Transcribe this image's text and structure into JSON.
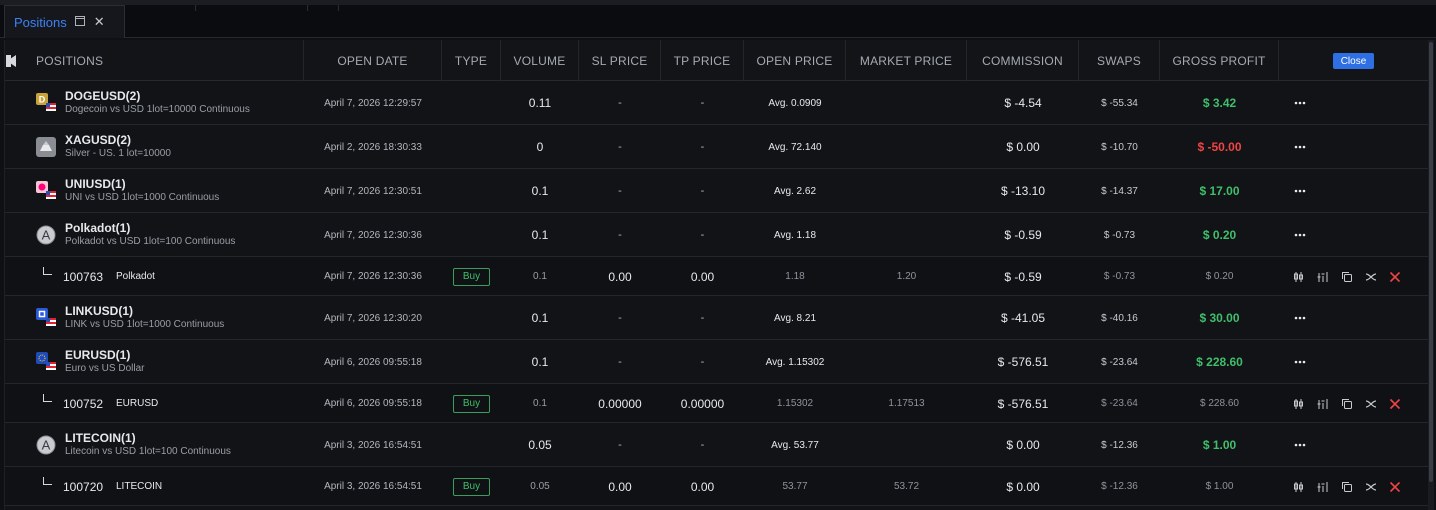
{
  "tab": {
    "label": "Positions"
  },
  "headers": {
    "positions": "POSITIONS",
    "open_date": "OPEN DATE",
    "type": "TYPE",
    "volume": "VOLUME",
    "sl_price": "SL PRICE",
    "tp_price": "TP PRICE",
    "open_price": "OPEN PRICE",
    "market_price": "MARKET PRICE",
    "commission": "COMMISSION",
    "swaps": "SWAPS",
    "gross_profit": "GROSS PROFIT",
    "close_button": "Close"
  },
  "rows": [
    {
      "kind": "group",
      "icon": "doge",
      "symbol": "DOGEUSD(2)",
      "desc": "Dogecoin vs USD 1lot=10000 Continuous",
      "date": "April 7, 2026 12:29:57",
      "volume": "0.11",
      "sl": "-",
      "tp": "-",
      "open": "Avg. 0.0909",
      "commission": "$ -4.54",
      "swaps": "$ -55.34",
      "profit": "$ 3.42",
      "sign": "pos"
    },
    {
      "kind": "group",
      "icon": "silver",
      "symbol": "XAGUSD(2)",
      "desc": "Silver - US. 1 lot=10000",
      "date": "April 2, 2026 18:30:33",
      "volume": "0",
      "sl": "-",
      "tp": "-",
      "open": "Avg. 72.140",
      "commission": "$ 0.00",
      "swaps": "$ -10.70",
      "profit": "$ -50.00",
      "sign": "neg"
    },
    {
      "kind": "group",
      "icon": "uni",
      "symbol": "UNIUSD(1)",
      "desc": "UNI vs USD 1lot=1000 Continuous",
      "date": "April 7, 2026 12:30:51",
      "volume": "0.1",
      "sl": "-",
      "tp": "-",
      "open": "Avg. 2.62",
      "commission": "$ -13.10",
      "swaps": "$ -14.37",
      "profit": "$ 17.00",
      "sign": "pos"
    },
    {
      "kind": "group",
      "icon": "letter",
      "symbol": "Polkadot(1)",
      "desc": "Polkadot vs USD 1lot=100 Continuous",
      "date": "April 7, 2026 12:30:36",
      "volume": "0.1",
      "sl": "-",
      "tp": "-",
      "open": "Avg. 1.18",
      "commission": "$ -0.59",
      "swaps": "$ -0.73",
      "profit": "$ 0.20",
      "sign": "pos"
    },
    {
      "kind": "sub",
      "ticket": "100763",
      "symbol": "Polkadot",
      "date": "April 7, 2026 12:30:36",
      "type": "Buy",
      "volume": "0.1",
      "sl": "0.00",
      "tp": "0.00",
      "open": "1.18",
      "market": "1.20",
      "commission": "$ -0.59",
      "swaps": "$ -0.73",
      "profit": "$ 0.20",
      "sign": "pos"
    },
    {
      "kind": "group",
      "icon": "link",
      "symbol": "LINKUSD(1)",
      "desc": "LINK vs USD 1lot=1000 Continuous",
      "date": "April 7, 2026 12:30:20",
      "volume": "0.1",
      "sl": "-",
      "tp": "-",
      "open": "Avg. 8.21",
      "commission": "$ -41.05",
      "swaps": "$ -40.16",
      "profit": "$ 30.00",
      "sign": "pos"
    },
    {
      "kind": "group",
      "icon": "eur",
      "symbol": "EURUSD(1)",
      "desc": "Euro vs US Dollar",
      "date": "April 6, 2026 09:55:18",
      "volume": "0.1",
      "sl": "-",
      "tp": "-",
      "open": "Avg. 1.15302",
      "commission": "$ -576.51",
      "swaps": "$ -23.64",
      "profit": "$ 228.60",
      "sign": "pos"
    },
    {
      "kind": "sub",
      "ticket": "100752",
      "symbol": "EURUSD",
      "date": "April 6, 2026 09:55:18",
      "type": "Buy",
      "volume": "0.1",
      "sl": "0.00000",
      "tp": "0.00000",
      "open": "1.15302",
      "market": "1.17513",
      "commission": "$ -576.51",
      "swaps": "$ -23.64",
      "profit": "$ 228.60",
      "sign": "pos"
    },
    {
      "kind": "group",
      "icon": "letter",
      "symbol": "LITECOIN(1)",
      "desc": "Litecoin vs USD 1lot=100 Continuous",
      "date": "April 3, 2026 16:54:51",
      "volume": "0.05",
      "sl": "-",
      "tp": "-",
      "open": "Avg. 53.77",
      "commission": "$ 0.00",
      "swaps": "$ -12.36",
      "profit": "$ 1.00",
      "sign": "pos"
    },
    {
      "kind": "sub",
      "ticket": "100720",
      "symbol": "LITECOIN",
      "date": "April 3, 2026 16:54:51",
      "type": "Buy",
      "volume": "0.05",
      "sl": "0.00",
      "tp": "0.00",
      "open": "53.77",
      "market": "53.72",
      "commission": "$ 0.00",
      "swaps": "$ -12.36",
      "profit": "$ 1.00",
      "sign": "pos"
    }
  ],
  "icons": {
    "tab_popout": "popout-icon",
    "tab_close": "close-icon",
    "row_menu": "more-icon",
    "sub_actions": [
      "chart-icon",
      "adjust-icon",
      "copy-icon",
      "reverse-icon",
      "close-position-icon"
    ]
  },
  "letter_icon_glyph": "A",
  "colors": {
    "accent": "#3b82f6",
    "positive": "#3fbf6b",
    "negative": "#ef4444",
    "close_btn": "#2f6fe4"
  }
}
